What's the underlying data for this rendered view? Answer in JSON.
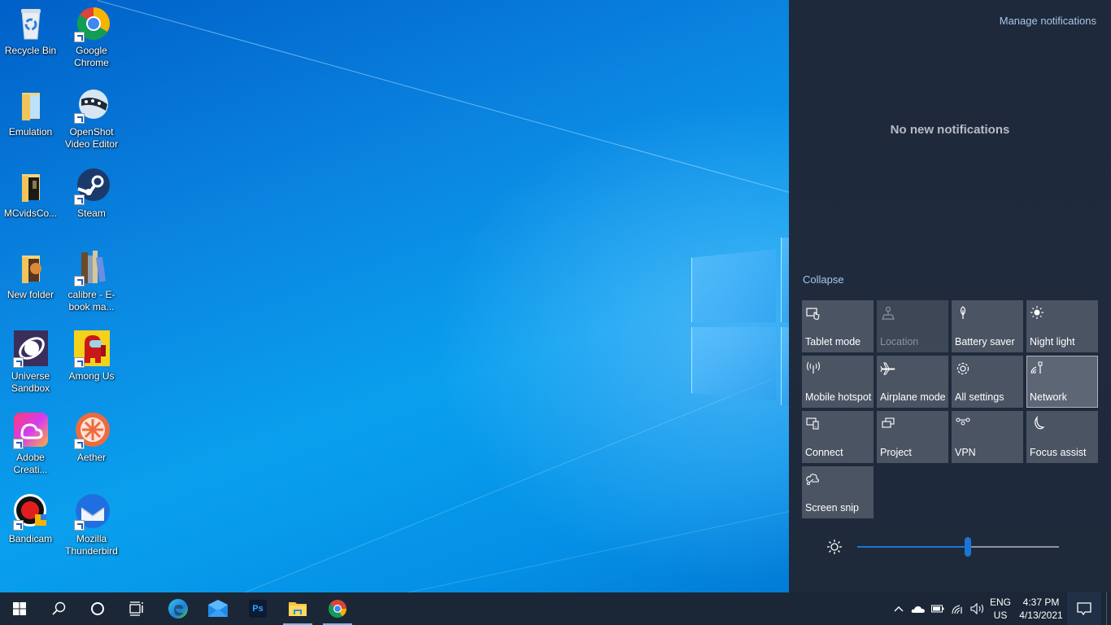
{
  "desktop": {
    "icons": [
      {
        "label": "Recycle Bin",
        "icon": "recycle-bin-icon",
        "shortcut": false
      },
      {
        "label": "Google Chrome",
        "icon": "chrome-icon",
        "shortcut": true
      },
      {
        "label": "Emulation",
        "icon": "folder-icon",
        "shortcut": false
      },
      {
        "label": "OpenShot Video Editor",
        "icon": "openshot-icon",
        "shortcut": true
      },
      {
        "label": "MCvidsCo...",
        "icon": "folder-icon",
        "shortcut": false
      },
      {
        "label": "Steam",
        "icon": "steam-icon",
        "shortcut": true
      },
      {
        "label": "New folder",
        "icon": "folder-icon",
        "shortcut": false
      },
      {
        "label": "calibre - E-book ma...",
        "icon": "calibre-icon",
        "shortcut": true
      },
      {
        "label": "Universe Sandbox",
        "icon": "universe-sandbox-icon",
        "shortcut": true
      },
      {
        "label": "Among Us",
        "icon": "among-us-icon",
        "shortcut": true
      },
      {
        "label": "Adobe Creati...",
        "icon": "adobe-cc-icon",
        "shortcut": true
      },
      {
        "label": "Aether",
        "icon": "aether-icon",
        "shortcut": true
      },
      {
        "label": "Bandicam",
        "icon": "bandicam-icon",
        "shortcut": true
      },
      {
        "label": "Mozilla Thunderbird",
        "icon": "thunderbird-icon",
        "shortcut": true
      }
    ]
  },
  "action_center": {
    "manage_notifications": "Manage notifications",
    "empty_message": "No new notifications",
    "collapse": "Collapse",
    "tiles": [
      {
        "label": "Tablet mode",
        "icon": "tablet-mode-icon",
        "state": "off"
      },
      {
        "label": "Location",
        "icon": "location-icon",
        "state": "disabled"
      },
      {
        "label": "Battery saver",
        "icon": "battery-saver-icon",
        "state": "off"
      },
      {
        "label": "Night light",
        "icon": "night-light-icon",
        "state": "off"
      },
      {
        "label": "Mobile hotspot",
        "icon": "mobile-hotspot-icon",
        "state": "off"
      },
      {
        "label": "Airplane mode",
        "icon": "airplane-icon",
        "state": "off"
      },
      {
        "label": "All settings",
        "icon": "gear-icon",
        "state": "off"
      },
      {
        "label": "Network",
        "icon": "network-icon",
        "state": "active"
      },
      {
        "label": "Connect",
        "icon": "connect-icon",
        "state": "off"
      },
      {
        "label": "Project",
        "icon": "project-icon",
        "state": "off"
      },
      {
        "label": "VPN",
        "icon": "vpn-icon",
        "state": "off"
      },
      {
        "label": "Focus assist",
        "icon": "moon-icon",
        "state": "off"
      },
      {
        "label": "Screen snip",
        "icon": "screen-snip-icon",
        "state": "off"
      }
    ],
    "brightness_percent": 55,
    "accent_color": "#1b74d6"
  },
  "taskbar": {
    "pinned": [
      {
        "name": "start",
        "icon": "windows-logo-icon",
        "running": false
      },
      {
        "name": "search",
        "icon": "search-icon",
        "running": false
      },
      {
        "name": "cortana",
        "icon": "cortana-icon",
        "running": false
      },
      {
        "name": "task-view",
        "icon": "task-view-icon",
        "running": false
      },
      {
        "name": "edge",
        "icon": "edge-icon",
        "running": false
      },
      {
        "name": "mail",
        "icon": "mail-icon",
        "running": false
      },
      {
        "name": "photoshop",
        "icon": "photoshop-icon",
        "running": false
      },
      {
        "name": "file-explorer",
        "icon": "file-explorer-icon",
        "running": true
      },
      {
        "name": "chrome",
        "icon": "chrome-icon",
        "running": true
      }
    ],
    "photoshop_label": "Ps",
    "tray": {
      "language_top": "ENG",
      "language_bottom": "US",
      "time": "4:37 PM",
      "date": "4/13/2021"
    }
  }
}
